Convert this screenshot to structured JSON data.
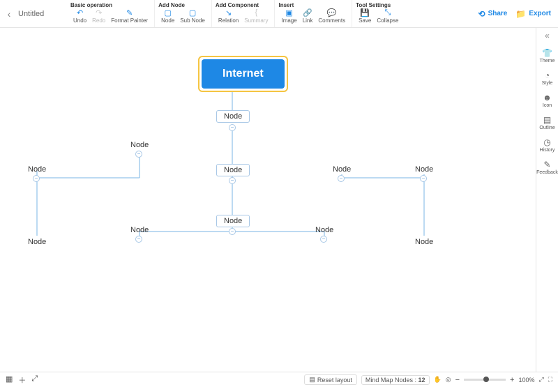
{
  "title": "Untitled",
  "topbar": {
    "groups": [
      {
        "title": "Basic operation",
        "items": [
          {
            "name": "undo",
            "label": "Undo",
            "icon": "↶",
            "disabled": false
          },
          {
            "name": "redo",
            "label": "Redo",
            "icon": "↷",
            "disabled": true
          },
          {
            "name": "format-painter",
            "label": "Format Painter",
            "icon": "✎",
            "disabled": false
          }
        ]
      },
      {
        "title": "Add Node",
        "items": [
          {
            "name": "node",
            "label": "Node",
            "icon": "▢",
            "disabled": false
          },
          {
            "name": "sub-node",
            "label": "Sub Node",
            "icon": "▢",
            "disabled": false
          }
        ]
      },
      {
        "title": "Add Component",
        "items": [
          {
            "name": "relation",
            "label": "Relation",
            "icon": "↘",
            "disabled": false
          },
          {
            "name": "summary",
            "label": "Summary",
            "icon": "{",
            "disabled": true
          }
        ]
      },
      {
        "title": "Insert",
        "items": [
          {
            "name": "image",
            "label": "Image",
            "icon": "▣",
            "disabled": false
          },
          {
            "name": "link",
            "label": "Link",
            "icon": "🔗",
            "disabled": false
          },
          {
            "name": "comments",
            "label": "Comments",
            "icon": "💬",
            "disabled": false
          }
        ]
      },
      {
        "title": "Tool Settings",
        "items": [
          {
            "name": "save",
            "label": "Save",
            "icon": "💾",
            "disabled": false
          },
          {
            "name": "collapse",
            "label": "Collapse",
            "icon": "⤡",
            "disabled": false
          }
        ]
      }
    ],
    "share_label": "Share",
    "export_label": "Export"
  },
  "rail": {
    "items": [
      {
        "name": "theme",
        "label": "Theme",
        "icon": "👕"
      },
      {
        "name": "style",
        "label": "Style",
        "icon": "◔"
      },
      {
        "name": "icon",
        "label": "Icon",
        "icon": "☻"
      },
      {
        "name": "outline",
        "label": "Outline",
        "icon": "▤"
      },
      {
        "name": "history",
        "label": "History",
        "icon": "◷"
      },
      {
        "name": "feedback",
        "label": "Feedback",
        "icon": "✎"
      }
    ]
  },
  "canvas": {
    "root": "Internet",
    "node_labels": {
      "n2": "Node",
      "n3": "Node",
      "n4": "Node",
      "t1": "Node",
      "t2": "Node",
      "t3": "Node",
      "t4": "Node",
      "t5": "Node",
      "t6": "Node",
      "t7": "Node",
      "t8": "Node"
    }
  },
  "bottombar": {
    "reset_label": "Reset layout",
    "count_label": "Mind Map Nodes :",
    "count": "12",
    "zoom_label": "100%"
  }
}
